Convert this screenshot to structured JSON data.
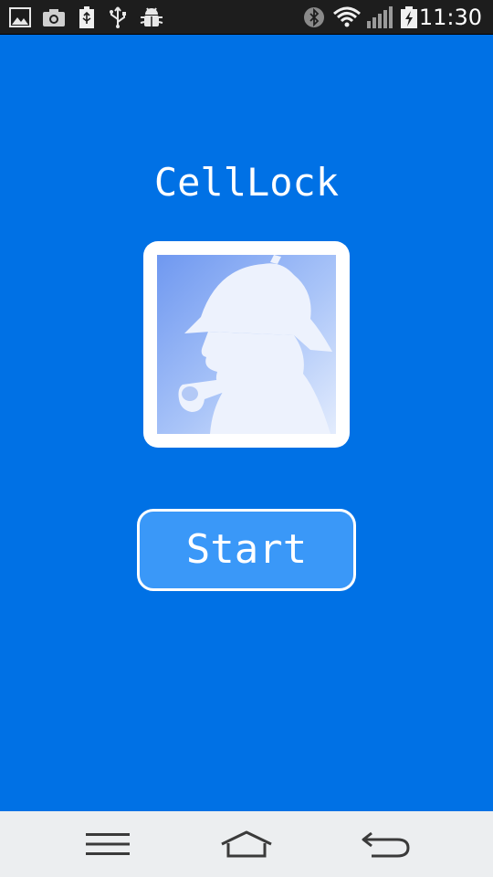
{
  "status_bar": {
    "time": "11:30",
    "left_icons": [
      "gallery-icon",
      "camera-icon",
      "battery-usb-icon",
      "usb-icon",
      "android-debug-icon"
    ],
    "right_icons": [
      "bluetooth-icon",
      "wifi-icon",
      "signal-icon",
      "battery-charging-icon"
    ]
  },
  "app": {
    "title": "CellLock",
    "logo_icon": "detective-silhouette-icon",
    "start_label": "Start"
  },
  "nav_bar": {
    "buttons": [
      "menu-icon",
      "home-icon",
      "back-icon"
    ]
  },
  "colors": {
    "background": "#0071e5",
    "button_fill": "#3a98f8",
    "status_bar": "#1d1d1d",
    "nav_bar": "#eceef0"
  }
}
